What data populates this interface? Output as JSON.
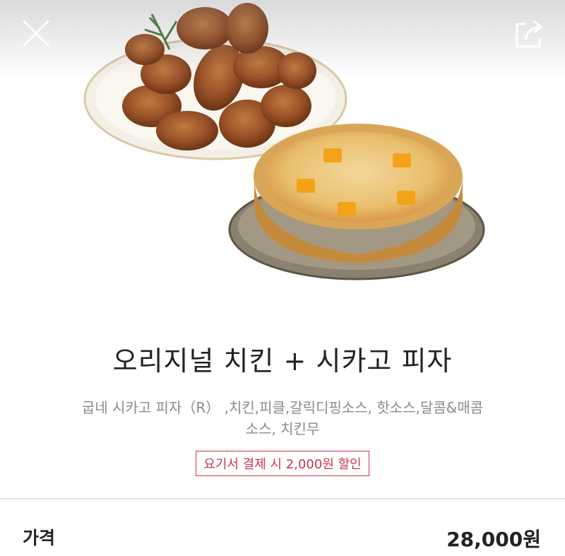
{
  "header": {
    "close_icon": "close-x-icon",
    "share_icon": "share-icon"
  },
  "product": {
    "title": "오리지널 치킨 + 시카고 피자",
    "description_line1": "굽네 시카고 피자（R） ,치킨,피클,갈릭디핑소스, 핫소스,달콤&매콤",
    "description_line2": "소스, 치킨무",
    "discount_badge": "요기서 결제 시 2,000원 할인"
  },
  "price": {
    "label": "가격",
    "value": "28,000원"
  },
  "colors": {
    "badge_accent": "#c9384a",
    "text_dark": "#222222",
    "text_muted": "#8a8a8a"
  }
}
